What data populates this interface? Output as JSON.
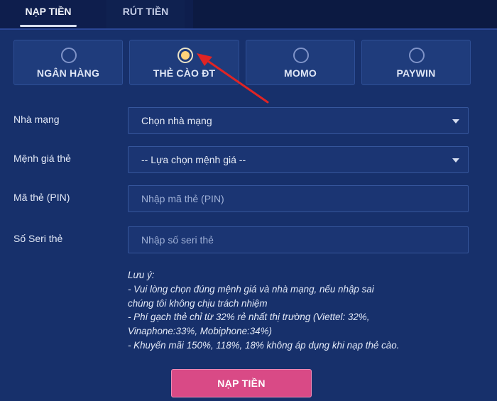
{
  "tabs": {
    "deposit": "NẠP TIỀN",
    "withdraw": "RÚT TIỀN"
  },
  "methods": [
    {
      "label": "NGÂN HÀNG",
      "selected": false
    },
    {
      "label": "THẺ CÀO ĐT",
      "selected": true
    },
    {
      "label": "MOMO",
      "selected": false
    },
    {
      "label": "PAYWIN",
      "selected": false
    }
  ],
  "form": {
    "carrier": {
      "label": "Nhà mạng",
      "value": "Chọn nhà mạng"
    },
    "denomination": {
      "label": "Mệnh giá thẻ",
      "value": "-- Lựa chọn mệnh giá --"
    },
    "pin": {
      "label": "Mã thẻ (PIN)",
      "placeholder": "Nhập mã thẻ (PIN)"
    },
    "serial": {
      "label": "Số Seri thẻ",
      "placeholder": "Nhập số seri thẻ"
    }
  },
  "note": {
    "title": "Lưu ý:",
    "lines": [
      "- Vui lòng chọn đúng mệnh giá và nhà mạng, nếu nhập sai",
      "chúng tôi không chịu trách nhiệm",
      "- Phí gạch thẻ chỉ từ 32% rẻ nhất thị trường (Viettel: 32%,",
      "Vinaphone:33%, Mobiphone:34%)",
      "- Khuyến mãi 150%, 118%, 18% không áp dụng khi nạp thẻ cào."
    ]
  },
  "submit_label": "NẠP TIỀN",
  "colors": {
    "background": "#17306b",
    "submit": "#d94a86",
    "annotation_arrow": "#e02424"
  }
}
